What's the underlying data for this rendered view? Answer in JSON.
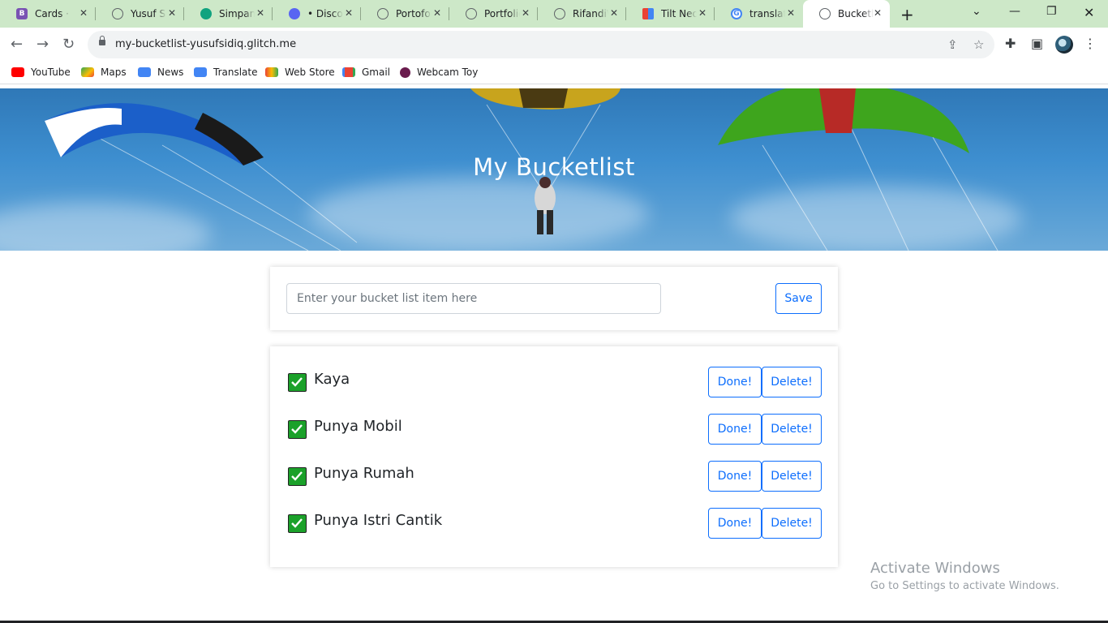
{
  "browser": {
    "tabs": [
      {
        "title": "Cards · Bootstrap",
        "icon": "bootstrap-icon",
        "color": "#7952b3"
      },
      {
        "title": "Yusuf Sidiq",
        "icon": "globe-icon",
        "color": "#5f6368"
      },
      {
        "title": "Simpan",
        "icon": "chatgpt-icon",
        "color": "#10a37f"
      },
      {
        "title": "• Discord",
        "icon": "discord-icon",
        "color": "#5865f2"
      },
      {
        "title": "Portofolio",
        "icon": "globe-icon",
        "color": "#5f6368"
      },
      {
        "title": "Portfolio",
        "icon": "globe-icon",
        "color": "#5f6368"
      },
      {
        "title": "RifandiW",
        "icon": "globe-icon",
        "color": "#5f6368"
      },
      {
        "title": "Tilt Neon",
        "icon": "google-fonts-icon",
        "color": "#ea4335"
      },
      {
        "title": "translate",
        "icon": "google-icon",
        "color": "#4285f4"
      },
      {
        "title": "Bucketlist",
        "icon": "globe-icon",
        "color": "#5f6368"
      }
    ],
    "url": "my-bucketlist-yusufsidiq.glitch.me",
    "bookmarks": [
      {
        "label": "YouTube",
        "color": "#ff0000"
      },
      {
        "label": "Maps",
        "color": "#34a853"
      },
      {
        "label": "News",
        "color": "#4285f4"
      },
      {
        "label": "Translate",
        "color": "#4285f4"
      },
      {
        "label": "Web Store",
        "color": "#ea4335"
      },
      {
        "label": "Gmail",
        "color": "#ea4335"
      },
      {
        "label": "Webcam Toy",
        "color": "#6a1b4d"
      }
    ]
  },
  "page": {
    "title": "My Bucketlist",
    "input_placeholder": "Enter your bucket list item here",
    "input_value": "",
    "save_label": "Save",
    "items": [
      {
        "text": "Kaya",
        "done": true,
        "done_label": "Done!",
        "delete_label": "Delete!"
      },
      {
        "text": "Punya Mobil",
        "done": true,
        "done_label": "Done!",
        "delete_label": "Delete!"
      },
      {
        "text": "Punya Rumah",
        "done": true,
        "done_label": "Done!",
        "delete_label": "Delete!"
      },
      {
        "text": "Punya Istri Cantik",
        "done": true,
        "done_label": "Done!",
        "delete_label": "Delete!"
      }
    ]
  },
  "watermark": {
    "line1": "Activate Windows",
    "line2": "Go to Settings to activate Windows."
  },
  "colors": {
    "accent": "#0d6efd",
    "check_green": "#1ba12a",
    "tabstrip": "#cde8c8"
  }
}
